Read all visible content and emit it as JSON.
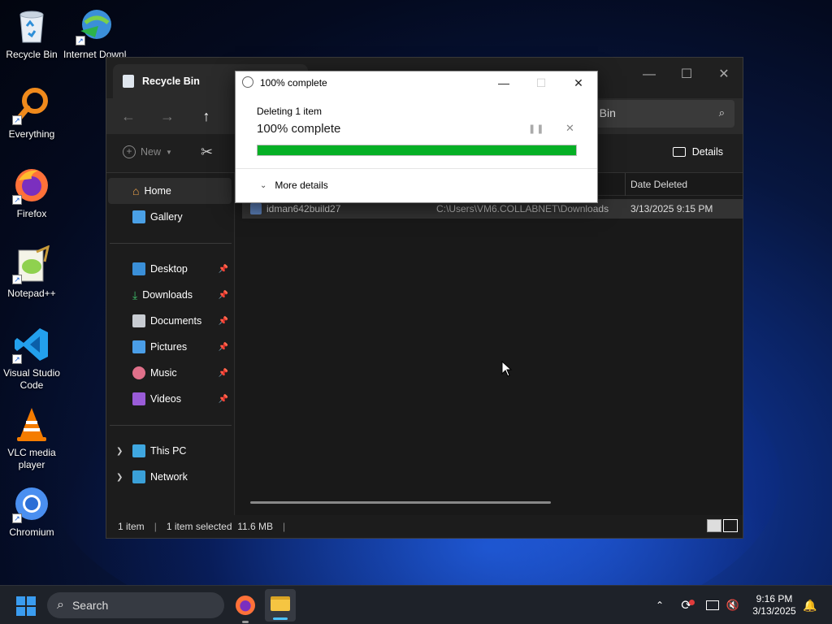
{
  "desktop": {
    "icons": [
      {
        "label": "Recycle Bin",
        "icon": "recycle-bin-icon"
      },
      {
        "label": "Internet Downlo",
        "icon": "internet-download-manager-icon"
      },
      {
        "label": "Everything",
        "icon": "everything-search-icon"
      },
      {
        "label": "Firefox",
        "icon": "firefox-icon"
      },
      {
        "label": "Notepad++",
        "icon": "notepad-plus-plus-icon"
      },
      {
        "label": "Visual Studio Code",
        "icon": "vscode-icon"
      },
      {
        "label": "VLC media player",
        "icon": "vlc-icon"
      },
      {
        "label": "Chromium",
        "icon": "chromium-icon"
      }
    ]
  },
  "explorer": {
    "tab_title": "Recycle Bin",
    "search_text": "e Bin",
    "toolbar": {
      "new_label": "New",
      "details_label": "Details"
    },
    "sidebar": {
      "items": [
        {
          "label": "Home"
        },
        {
          "label": "Gallery"
        },
        {
          "label": "Desktop"
        },
        {
          "label": "Downloads"
        },
        {
          "label": "Documents"
        },
        {
          "label": "Pictures"
        },
        {
          "label": "Music"
        },
        {
          "label": "Videos"
        },
        {
          "label": "This PC"
        },
        {
          "label": "Network"
        }
      ]
    },
    "columns": {
      "date_deleted": "Date Deleted"
    },
    "row": {
      "name": "idman642build27",
      "original_location": "C:\\Users\\VM6.COLLABNET\\Downloads",
      "date_deleted": "3/13/2025 9:15 PM"
    },
    "status": {
      "count": "1 item",
      "selected": "1 item selected  11.6 MB"
    }
  },
  "dialog": {
    "title": "100% complete",
    "operation": "Deleting 1 item",
    "percent_text": "100% complete",
    "progress": 1.0,
    "more_details": "More details",
    "accent": "#06b025"
  },
  "taskbar": {
    "search_label": "Search",
    "time": "9:16 PM",
    "date": "3/13/2025"
  }
}
